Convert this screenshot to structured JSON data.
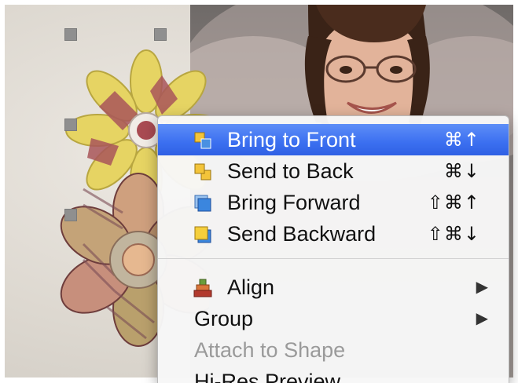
{
  "context_menu": {
    "arrange_items": [
      {
        "label": "Bring to Front",
        "shortcut": "⌘↑",
        "icon": "bring-to-front-icon",
        "highlighted": true
      },
      {
        "label": "Send to Back",
        "shortcut": "⌘↓",
        "icon": "send-to-back-icon"
      },
      {
        "label": "Bring Forward",
        "shortcut": "⇧⌘↑",
        "icon": "bring-forward-icon"
      },
      {
        "label": "Send Backward",
        "shortcut": "⇧⌘↓",
        "icon": "send-backward-icon"
      }
    ],
    "align": {
      "label": "Align",
      "icon": "align-icon",
      "submenu_arrow": "▶"
    },
    "group": {
      "label": "Group",
      "submenu_arrow": "▶"
    },
    "attach_to_shape": {
      "label": "Attach to Shape",
      "enabled": false
    },
    "hi_res_preview": {
      "label": "Hi-Res Preview"
    }
  },
  "colors": {
    "highlight": "#3b6ff0",
    "menu_background": "#f7f7f7",
    "disabled_text": "#9a9a9a",
    "selection_handle": "#8f8f8f"
  }
}
